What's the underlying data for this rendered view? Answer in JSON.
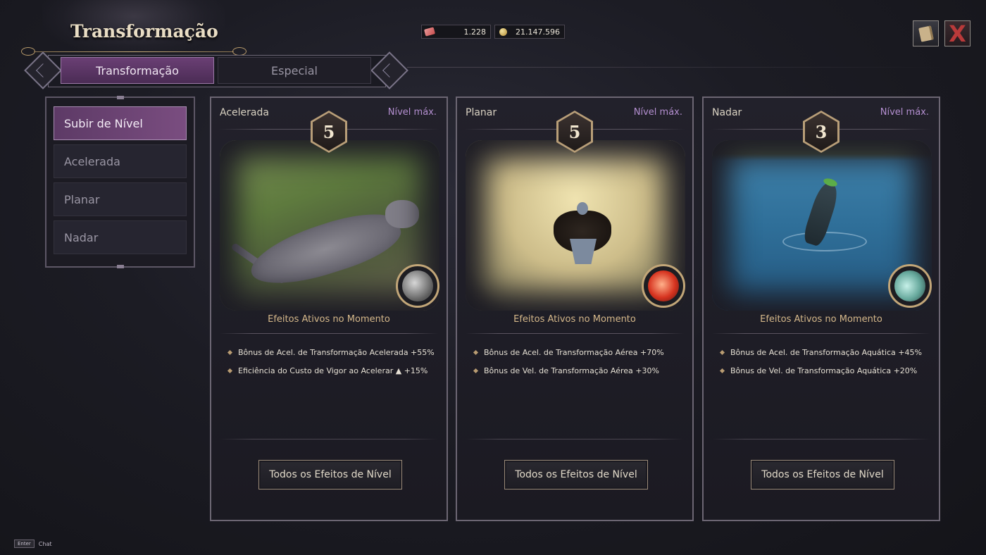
{
  "header": {
    "title": "Transformação"
  },
  "currencies": [
    {
      "icon": "ticket-icon",
      "value": "1.228"
    },
    {
      "icon": "coin-icon",
      "value": "21.147.596"
    }
  ],
  "top_buttons": {
    "book_icon": "book-icon",
    "close_label": "X"
  },
  "tabs": [
    {
      "label": "Transformação",
      "active": true
    },
    {
      "label": "Especial",
      "active": false
    }
  ],
  "sidebar": {
    "items": [
      {
        "label": "Subir de Nível",
        "active": true
      },
      {
        "label": "Acelerada",
        "active": false
      },
      {
        "label": "Planar",
        "active": false
      },
      {
        "label": "Nadar",
        "active": false
      }
    ]
  },
  "cards": [
    {
      "name": "Acelerada",
      "max_label": "Nível máx.",
      "level": "5",
      "scene_icon": "leopard-icon",
      "active_title": "Efeitos Ativos no Momento",
      "effects": [
        "Bônus de Acel. de Transformação Acelerada +55%",
        "Eficiência do Custo de Vigor ao Acelerar ▲ +15%"
      ],
      "button_label": "Todos os Efeitos de Nível"
    },
    {
      "name": "Planar",
      "max_label": "Nível máx.",
      "level": "5",
      "scene_icon": "bird-icon",
      "active_title": "Efeitos Ativos no Momento",
      "effects": [
        "Bônus de Acel. de Transformação Aérea +70%",
        "Bônus de Vel. de Transformação Aérea  +30%"
      ],
      "button_label": "Todos os Efeitos de Nível"
    },
    {
      "name": "Nadar",
      "max_label": "Nível máx.",
      "level": "3",
      "scene_icon": "seal-icon",
      "active_title": "Efeitos Ativos no Momento",
      "effects": [
        "Bônus de Acel. de Transformação Aquática +45%",
        "Bônus de Vel. de Transformação Aquática +20%"
      ],
      "button_label": "Todos os Efeitos de Nível"
    }
  ],
  "footer": {
    "key_label": "Enter",
    "hint_label": "Chat"
  },
  "colors": {
    "accent_purple": "#6a3f74",
    "gold": "#c2a678",
    "max_level": "#b48fd0"
  }
}
